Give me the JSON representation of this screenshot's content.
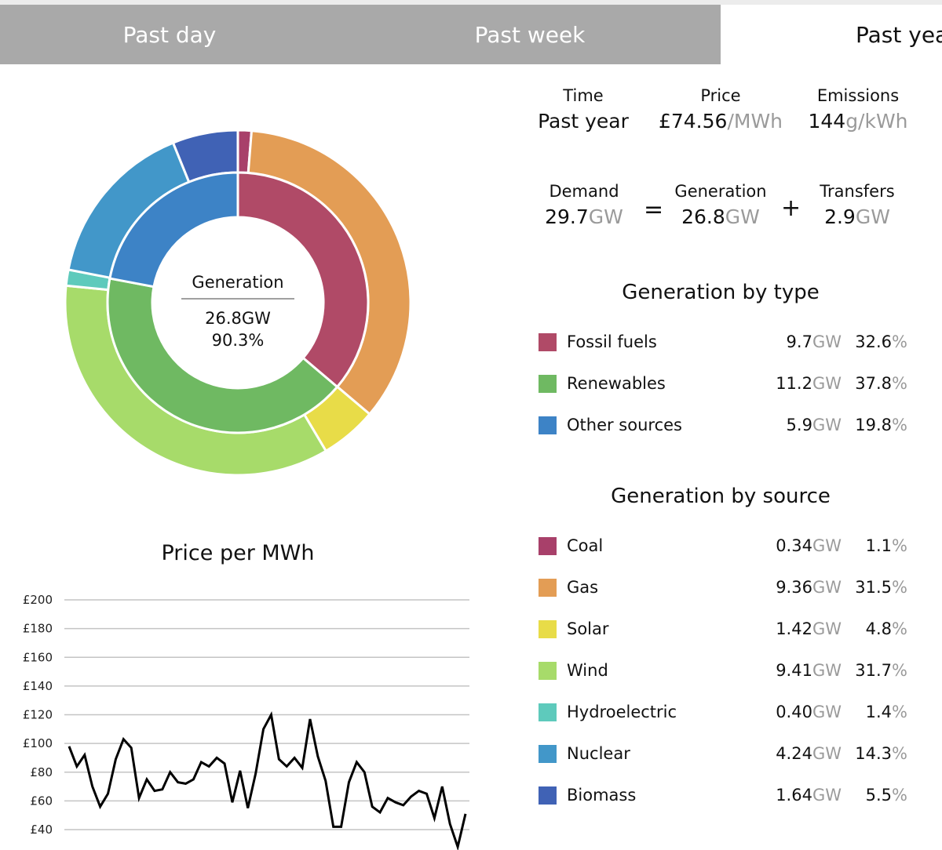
{
  "tabs": [
    {
      "label": "Past day",
      "active": false
    },
    {
      "label": "Past week",
      "active": false
    },
    {
      "label": "Past year",
      "active": true
    }
  ],
  "summary": {
    "time": {
      "label": "Time",
      "value": "Past year"
    },
    "price": {
      "label": "Price",
      "value": "£74.56",
      "unit": "/MWh"
    },
    "emissions": {
      "label": "Emissions",
      "value": "144",
      "unit": "g/kWh"
    },
    "demand": {
      "label": "Demand",
      "value": "29.7",
      "unit": "GW"
    },
    "equals": "=",
    "generation": {
      "label": "Generation",
      "value": "26.8",
      "unit": "GW"
    },
    "plus": "+",
    "transfers": {
      "label": "Transfers",
      "value": "2.9",
      "unit": "GW"
    }
  },
  "donut_center": {
    "title": "Generation",
    "value": "26.8GW",
    "percent": "90.3%"
  },
  "generation_by_type": {
    "title": "Generation by type",
    "unit_gw": "GW",
    "unit_pct": "%",
    "items": [
      {
        "name": "Fossil fuels",
        "gw": "9.7",
        "pct": "32.6",
        "color": "#b04a67"
      },
      {
        "name": "Renewables",
        "gw": "11.2",
        "pct": "37.8",
        "color": "#6fb962"
      },
      {
        "name": "Other sources",
        "gw": "5.9",
        "pct": "19.8",
        "color": "#3d83c6"
      }
    ]
  },
  "generation_by_source": {
    "title": "Generation by source",
    "unit_gw": "GW",
    "unit_pct": "%",
    "items": [
      {
        "name": "Coal",
        "gw": "0.34",
        "pct": "1.1",
        "color": "#a8406a"
      },
      {
        "name": "Gas",
        "gw": "9.36",
        "pct": "31.5",
        "color": "#e39d55"
      },
      {
        "name": "Solar",
        "gw": "1.42",
        "pct": "4.8",
        "color": "#e8dc48"
      },
      {
        "name": "Wind",
        "gw": "9.41",
        "pct": "31.7",
        "color": "#a7db6a"
      },
      {
        "name": "Hydroelectric",
        "gw": "0.40",
        "pct": "1.4",
        "color": "#5ecabc"
      },
      {
        "name": "Nuclear",
        "gw": "4.24",
        "pct": "14.3",
        "color": "#4297c9"
      },
      {
        "name": "Biomass",
        "gw": "1.64",
        "pct": "5.5",
        "color": "#4062b5"
      }
    ]
  },
  "chart_data": [
    {
      "type": "pie",
      "title": "Generation",
      "inner_ring": {
        "categories": [
          "Fossil fuels",
          "Renewables",
          "Other sources"
        ],
        "values": [
          9.7,
          11.2,
          5.9
        ],
        "colors": [
          "#b04a67",
          "#6fb962",
          "#3d83c6"
        ]
      },
      "outer_ring": {
        "categories": [
          "Coal",
          "Gas",
          "Solar",
          "Wind",
          "Hydroelectric",
          "Nuclear",
          "Biomass"
        ],
        "values": [
          0.34,
          9.36,
          1.42,
          9.41,
          0.4,
          4.24,
          1.64
        ],
        "colors": [
          "#a8406a",
          "#e39d55",
          "#e8dc48",
          "#a7db6a",
          "#5ecabc",
          "#4297c9",
          "#4062b5"
        ]
      }
    },
    {
      "type": "line",
      "title": "Price per MWh",
      "xlabel": "",
      "ylabel": "",
      "ylim": [
        40,
        200
      ],
      "yticks": [
        200,
        180,
        160,
        140,
        120,
        100,
        80,
        60,
        40
      ],
      "ytick_labels": [
        "£200",
        "£180",
        "£160",
        "£140",
        "£120",
        "£100",
        "£80",
        "£60",
        "£40"
      ],
      "grid": true,
      "series": [
        {
          "name": "Price",
          "color": "#000000",
          "values": [
            98,
            84,
            92,
            70,
            56,
            65,
            89,
            103,
            97,
            62,
            75,
            67,
            68,
            80,
            73,
            72,
            75,
            87,
            84,
            90,
            86,
            59,
            81,
            55,
            79,
            110,
            120,
            89,
            84,
            90,
            83,
            117,
            91,
            74,
            42,
            42,
            73,
            87,
            80,
            56,
            52,
            62,
            59,
            57,
            63,
            67,
            65,
            48,
            70,
            44,
            28,
            51
          ]
        }
      ]
    }
  ]
}
